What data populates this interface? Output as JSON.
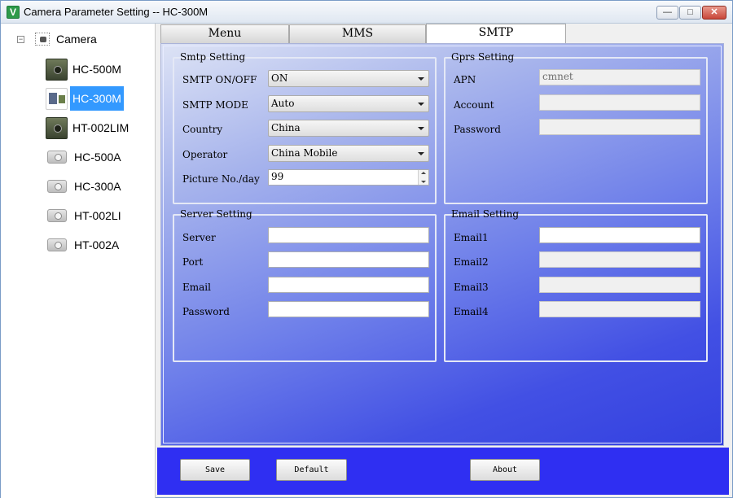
{
  "window": {
    "title": "Camera Parameter Setting -- HC-300M",
    "app_icon": "v-app-icon",
    "controls": {
      "minimize": "—",
      "maximize": "□",
      "close": "✕"
    }
  },
  "tree": {
    "expander": "⊟",
    "root": "Camera",
    "items": [
      {
        "label": "HC-500M",
        "icon": "camera-thumb-icon"
      },
      {
        "label": "HC-300M",
        "icon": "camera-thumb-icon",
        "selected": true
      },
      {
        "label": "HT-002LIM",
        "icon": "camera-thumb-icon"
      },
      {
        "label": "HC-500A",
        "icon": "camera-icon"
      },
      {
        "label": "HC-300A",
        "icon": "camera-icon"
      },
      {
        "label": "HT-002LI",
        "icon": "camera-icon"
      },
      {
        "label": "HT-002A",
        "icon": "camera-icon"
      }
    ]
  },
  "tabs": [
    {
      "label": "Menu"
    },
    {
      "label": "MMS"
    },
    {
      "label": "SMTP",
      "active": true
    }
  ],
  "smtp_setting": {
    "title": "Smtp Setting",
    "smtp_onoff": {
      "label": "SMTP ON/OFF",
      "value": "ON"
    },
    "smtp_mode": {
      "label": "SMTP MODE",
      "value": "Auto"
    },
    "country": {
      "label": "Country",
      "value": "China"
    },
    "operator": {
      "label": "Operator",
      "value": "China Mobile"
    },
    "picture_no": {
      "label": "Picture No./day",
      "value": "99"
    }
  },
  "gprs_setting": {
    "title": "Gprs Setting",
    "apn": {
      "label": "APN",
      "value": "cmnet"
    },
    "account": {
      "label": "Account",
      "value": ""
    },
    "password": {
      "label": "Password",
      "value": ""
    }
  },
  "server_setting": {
    "title": "Server Setting",
    "server": {
      "label": "Server",
      "value": ""
    },
    "port": {
      "label": "Port",
      "value": ""
    },
    "email": {
      "label": "Email",
      "value": ""
    },
    "password": {
      "label": "Password",
      "value": ""
    }
  },
  "email_setting": {
    "title": "Email Setting",
    "email1": {
      "label": "Email1",
      "value": ""
    },
    "email2": {
      "label": "Email2",
      "value": ""
    },
    "email3": {
      "label": "Email3",
      "value": ""
    },
    "email4": {
      "label": "Email4",
      "value": ""
    }
  },
  "buttons": {
    "save": "Save",
    "default": "Default",
    "about": "About"
  },
  "colors": {
    "selection": "#3399ff",
    "panel_dark": "#3340e0",
    "panel_light": "#dde3f5",
    "bottom_bar": "#2f2ff2"
  }
}
